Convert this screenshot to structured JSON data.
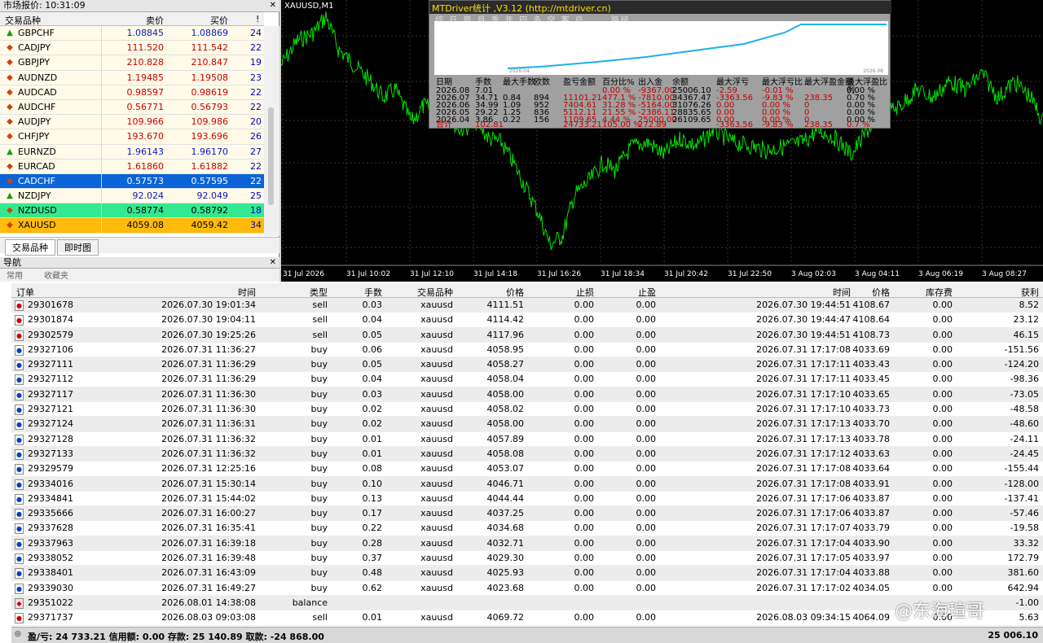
{
  "market_watch": {
    "title": "市场报价: 10:31:09",
    "headers": {
      "symbol": "交易品种",
      "bid": "卖价",
      "ask": "买价",
      "spread": "!"
    },
    "rows": [
      {
        "sym": "GBPCHF",
        "bid": "1.08845",
        "ask": "1.08869",
        "spr": "24",
        "dir": "up",
        "cls": "blue"
      },
      {
        "sym": "CADJPY",
        "bid": "111.520",
        "ask": "111.542",
        "spr": "22",
        "dir": "dn",
        "cls": "red"
      },
      {
        "sym": "GBPJPY",
        "bid": "210.828",
        "ask": "210.847",
        "spr": "19",
        "dir": "dn",
        "cls": "red"
      },
      {
        "sym": "AUDNZD",
        "bid": "1.19485",
        "ask": "1.19508",
        "spr": "23",
        "dir": "dn",
        "cls": "red"
      },
      {
        "sym": "AUDCAD",
        "bid": "0.98597",
        "ask": "0.98619",
        "spr": "22",
        "dir": "dn",
        "cls": "red"
      },
      {
        "sym": "AUDCHF",
        "bid": "0.56771",
        "ask": "0.56793",
        "spr": "22",
        "dir": "dn",
        "cls": "red"
      },
      {
        "sym": "AUDJPY",
        "bid": "109.966",
        "ask": "109.986",
        "spr": "20",
        "dir": "dn",
        "cls": "red"
      },
      {
        "sym": "CHFJPY",
        "bid": "193.670",
        "ask": "193.696",
        "spr": "26",
        "dir": "dn",
        "cls": "red"
      },
      {
        "sym": "EURNZD",
        "bid": "1.96143",
        "ask": "1.96170",
        "spr": "27",
        "dir": "up",
        "cls": "blue"
      },
      {
        "sym": "EURCAD",
        "bid": "1.61860",
        "ask": "1.61882",
        "spr": "22",
        "dir": "dn",
        "cls": "red"
      },
      {
        "sym": "CADCHF",
        "bid": "0.57573",
        "ask": "0.57595",
        "spr": "22",
        "dir": "dn",
        "cls": "sel"
      },
      {
        "sym": "NZDJPY",
        "bid": "92.024",
        "ask": "92.049",
        "spr": "25",
        "dir": "up",
        "cls": "blue"
      },
      {
        "sym": "NZDUSD",
        "bid": "0.58774",
        "ask": "0.58792",
        "spr": "18",
        "dir": "dn",
        "cls": "grn"
      },
      {
        "sym": "XAUUSD",
        "bid": "4059.08",
        "ask": "4059.42",
        "spr": "34",
        "dir": "dn",
        "cls": "org"
      }
    ],
    "tabs": [
      "交易品种",
      "即时图"
    ]
  },
  "navigator": {
    "title": "导航",
    "tabs": [
      "常用",
      "收藏夹"
    ]
  },
  "chart": {
    "title": "XAUUSD,M1",
    "x_labels": [
      "31 Jul 2026",
      "31 Jul 10:02",
      "31 Jul 12:10",
      "31 Jul 14:18",
      "31 Jul 16:26",
      "31 Jul 18:34",
      "31 Jul 20:42",
      "31 Jul 22:50",
      "3 Aug 02:03",
      "3 Aug 04:11",
      "3 Aug 06:19",
      "3 Aug 08:27"
    ]
  },
  "stats": {
    "title": "MTDriver统计 ,V3.12 (http://mtdriver.cn)",
    "menu": "综 日 周 月 季 年 円 多 空 客 户",
    "menu_extra": "路径",
    "eq_labels": [
      "2026.04",
      "2026.08"
    ],
    "headers": [
      "日期",
      "手数",
      "最大手数",
      "欧数",
      "盈亏金额",
      "百分比%",
      "出入金",
      "余额",
      "最大浮亏",
      "最大浮亏比",
      "最大浮盈金额",
      "最大浮盈比例"
    ],
    "rows": [
      [
        "2026.08",
        "7.01",
        "",
        "",
        "",
        "0.00 %",
        "-9367.00",
        "25006.10",
        "-2.59",
        "-0.01 %",
        "",
        "0.00 %"
      ],
      [
        "2026.07",
        "34.71",
        "0.84",
        "894",
        "11101.21",
        "477.1 %",
        "-7810.00",
        "34367.47",
        "-3363.56",
        "-9.83 %",
        "238.35",
        "0.70 %"
      ],
      [
        "2026.06",
        "34.99",
        "1.09",
        "952",
        "7404.61",
        "31.28 %",
        "-5164.00",
        "31076.26",
        "0.00",
        "0.00 %",
        "0",
        "0.00 %"
      ],
      [
        "2026.05",
        "29.22",
        "1.25",
        "836",
        "5112.11",
        "21.55 %",
        "-2386.11",
        "28835.65",
        "0.00",
        "0.00 %",
        "0",
        "0.00 %"
      ],
      [
        "2026.04",
        "3.86",
        "0.22",
        "156",
        "1109.65",
        "4.44 %",
        "25000.00",
        "26109.65",
        "0.00",
        "0.00 %",
        "0",
        "0.00 %"
      ]
    ],
    "total": [
      "合计",
      "102.81",
      "",
      "",
      "24733.21",
      "105.00 %",
      "272.89",
      "",
      "-3363.56",
      "-9.83 %",
      "238.35",
      "0.7 %"
    ]
  },
  "orders": {
    "headers": [
      "订单",
      "时间",
      "类型",
      "手数",
      "交易品种",
      "价格",
      "止损",
      "止盈",
      "时间",
      "价格",
      "库存费",
      "获利"
    ],
    "rows": [
      [
        "29301678",
        "2026.07.30 19:01:34",
        "sell",
        "0.03",
        "xauusd",
        "4111.51",
        "0.00",
        "0.00",
        "2026.07.30 19:44:51",
        "4108.67",
        "0.00",
        "8.52"
      ],
      [
        "29301874",
        "2026.07.30 19:04:11",
        "sell",
        "0.04",
        "xauusd",
        "4114.42",
        "0.00",
        "0.00",
        "2026.07.30 19:44:47",
        "4108.64",
        "0.00",
        "23.12"
      ],
      [
        "29302579",
        "2026.07.30 19:25:26",
        "sell",
        "0.05",
        "xauusd",
        "4117.96",
        "0.00",
        "0.00",
        "2026.07.30 19:44:51",
        "4108.73",
        "0.00",
        "46.15"
      ],
      [
        "29327106",
        "2026.07.31 11:36:27",
        "buy",
        "0.06",
        "xauusd",
        "4058.95",
        "0.00",
        "0.00",
        "2026.07.31 17:17:08",
        "4033.69",
        "0.00",
        "-151.56"
      ],
      [
        "29327111",
        "2026.07.31 11:36:29",
        "buy",
        "0.05",
        "xauusd",
        "4058.27",
        "0.00",
        "0.00",
        "2026.07.31 17:17:11",
        "4033.43",
        "0.00",
        "-124.20"
      ],
      [
        "29327112",
        "2026.07.31 11:36:29",
        "buy",
        "0.04",
        "xauusd",
        "4058.04",
        "0.00",
        "0.00",
        "2026.07.31 17:17:11",
        "4033.45",
        "0.00",
        "-98.36"
      ],
      [
        "29327117",
        "2026.07.31 11:36:30",
        "buy",
        "0.03",
        "xauusd",
        "4058.00",
        "0.00",
        "0.00",
        "2026.07.31 17:17:10",
        "4033.65",
        "0.00",
        "-73.05"
      ],
      [
        "29327121",
        "2026.07.31 11:36:30",
        "buy",
        "0.02",
        "xauusd",
        "4058.02",
        "0.00",
        "0.00",
        "2026.07.31 17:17:10",
        "4033.73",
        "0.00",
        "-48.58"
      ],
      [
        "29327124",
        "2026.07.31 11:36:31",
        "buy",
        "0.02",
        "xauusd",
        "4058.00",
        "0.00",
        "0.00",
        "2026.07.31 17:17:13",
        "4033.70",
        "0.00",
        "-48.60"
      ],
      [
        "29327128",
        "2026.07.31 11:36:32",
        "buy",
        "0.01",
        "xauusd",
        "4057.89",
        "0.00",
        "0.00",
        "2026.07.31 17:17:13",
        "4033.78",
        "0.00",
        "-24.11"
      ],
      [
        "29327133",
        "2026.07.31 11:36:32",
        "buy",
        "0.01",
        "xauusd",
        "4058.08",
        "0.00",
        "0.00",
        "2026.07.31 17:17:12",
        "4033.63",
        "0.00",
        "-24.45"
      ],
      [
        "29329579",
        "2026.07.31 12:25:16",
        "buy",
        "0.08",
        "xauusd",
        "4053.07",
        "0.00",
        "0.00",
        "2026.07.31 17:17:08",
        "4033.64",
        "0.00",
        "-155.44"
      ],
      [
        "29334016",
        "2026.07.31 15:30:14",
        "buy",
        "0.10",
        "xauusd",
        "4046.71",
        "0.00",
        "0.00",
        "2026.07.31 17:17:08",
        "4033.91",
        "0.00",
        "-128.00"
      ],
      [
        "29334841",
        "2026.07.31 15:44:02",
        "buy",
        "0.13",
        "xauusd",
        "4044.44",
        "0.00",
        "0.00",
        "2026.07.31 17:17:06",
        "4033.87",
        "0.00",
        "-137.41"
      ],
      [
        "29335666",
        "2026.07.31 16:00:27",
        "buy",
        "0.17",
        "xauusd",
        "4037.25",
        "0.00",
        "0.00",
        "2026.07.31 17:17:06",
        "4033.87",
        "0.00",
        "-57.46"
      ],
      [
        "29337628",
        "2026.07.31 16:35:41",
        "buy",
        "0.22",
        "xauusd",
        "4034.68",
        "0.00",
        "0.00",
        "2026.07.31 17:17:07",
        "4033.79",
        "0.00",
        "-19.58"
      ],
      [
        "29337963",
        "2026.07.31 16:39:18",
        "buy",
        "0.28",
        "xauusd",
        "4032.71",
        "0.00",
        "0.00",
        "2026.07.31 17:17:04",
        "4033.90",
        "0.00",
        "33.32"
      ],
      [
        "29338052",
        "2026.07.31 16:39:48",
        "buy",
        "0.37",
        "xauusd",
        "4029.30",
        "0.00",
        "0.00",
        "2026.07.31 17:17:05",
        "4033.97",
        "0.00",
        "172.79"
      ],
      [
        "29338401",
        "2026.07.31 16:43:09",
        "buy",
        "0.48",
        "xauusd",
        "4025.93",
        "0.00",
        "0.00",
        "2026.07.31 17:17:04",
        "4033.88",
        "0.00",
        "381.60"
      ],
      [
        "29339030",
        "2026.07.31 16:49:27",
        "buy",
        "0.62",
        "xauusd",
        "4023.68",
        "0.00",
        "0.00",
        "2026.07.31 17:17:02",
        "4034.05",
        "0.00",
        "642.94"
      ],
      [
        "29351022",
        "2026.08.01 14:38:08",
        "balance",
        "",
        "",
        "",
        "",
        "",
        "",
        "",
        "",
        "-1.00"
      ],
      [
        "29371737",
        "2026.08.03 09:03:08",
        "sell",
        "0.01",
        "xauusd",
        "4069.72",
        "0.00",
        "0.00",
        "2026.08.03 09:34:15",
        "4064.09",
        "0.00",
        "5.63"
      ]
    ],
    "summary": "盈/亏: 24 733.21  信用额: 0.00  存款: 25 140.89  取款: -24 868.00",
    "balance": "25 006.10"
  },
  "watermark": "@东海瑄哥"
}
